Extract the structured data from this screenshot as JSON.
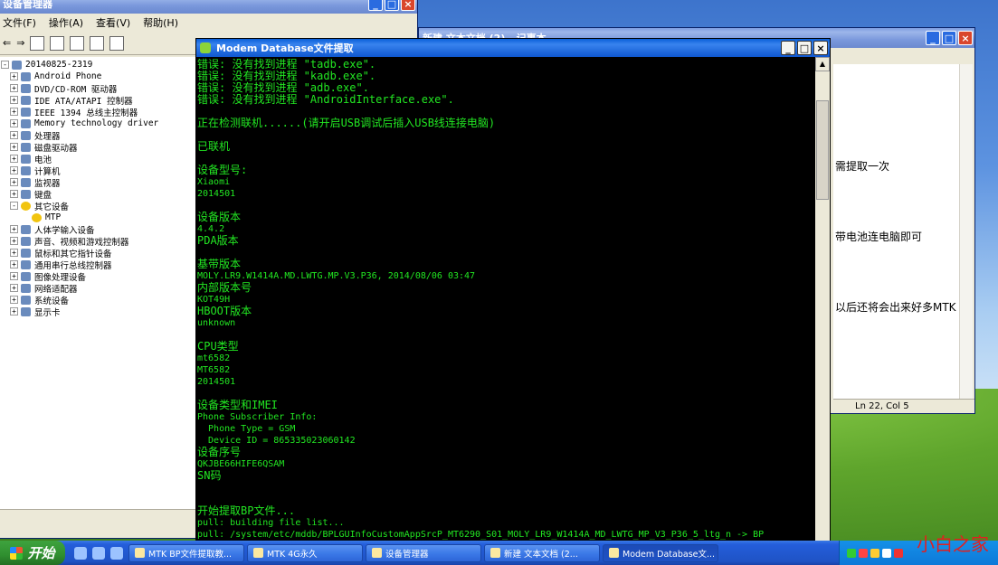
{
  "device_manager": {
    "title": "设备管理器",
    "menu": [
      "文件(F)",
      "操作(A)",
      "查看(V)",
      "帮助(H)"
    ],
    "root": "20140825-2319",
    "tree": [
      {
        "label": "Android Phone",
        "exp": "+"
      },
      {
        "label": "DVD/CD-ROM 驱动器",
        "exp": "+"
      },
      {
        "label": "IDE ATA/ATAPI 控制器",
        "exp": "+"
      },
      {
        "label": "IEEE 1394 总线主控制器",
        "exp": "+"
      },
      {
        "label": "Memory technology driver",
        "exp": "+"
      },
      {
        "label": "处理器",
        "exp": "+"
      },
      {
        "label": "磁盘驱动器",
        "exp": "+"
      },
      {
        "label": "电池",
        "exp": "+"
      },
      {
        "label": "计算机",
        "exp": "+"
      },
      {
        "label": "监视器",
        "exp": "+"
      },
      {
        "label": "键盘",
        "exp": "+"
      },
      {
        "label": "其它设备",
        "exp": "-"
      },
      {
        "label": "MTP",
        "exp": "",
        "child": true
      },
      {
        "label": "人体学输入设备",
        "exp": "+"
      },
      {
        "label": "声音、视频和游戏控制器",
        "exp": "+"
      },
      {
        "label": "鼠标和其它指针设备",
        "exp": "+"
      },
      {
        "label": "通用串行总线控制器",
        "exp": "+"
      },
      {
        "label": "图像处理设备",
        "exp": "+"
      },
      {
        "label": "网络适配器",
        "exp": "+"
      },
      {
        "label": "系统设备",
        "exp": "+"
      },
      {
        "label": "显示卡",
        "exp": "+"
      }
    ]
  },
  "notepad": {
    "title": "新建 文本文档 (2) - 记事本",
    "lines": [
      "需提取一次",
      "带电池连电脑即可",
      "以后还将会出来好多MTK"
    ],
    "status": "Ln 22, Col 5"
  },
  "console": {
    "title": "Modem Database文件提取",
    "lines": [
      "错误: 没有找到进程 \"tadb.exe\".",
      "错误: 没有找到进程 \"kadb.exe\".",
      "错误: 没有找到进程 \"adb.exe\".",
      "错误: 没有找到进程 \"AndroidInterface.exe\".",
      "",
      "正在检测联机......(请开启USB调试后插入USB线连接电脑)",
      "",
      "已联机",
      "",
      "设备型号:",
      "Xiaomi",
      "2014501",
      "",
      "设备版本",
      "4.4.2",
      "PDA版本",
      "",
      "基带版本",
      "MOLY.LR9.W1414A.MD.LWTG.MP.V3.P36, 2014/08/06 03:47",
      "内部版本号",
      "KOT49H",
      "HBOOT版本",
      "unknown",
      "",
      "CPU类型",
      "mt6582",
      "MT6582",
      "2014501",
      "",
      "设备类型和IMEI",
      "Phone Subscriber Info:",
      "  Phone Type = GSM",
      "  Device ID = 865335023060142",
      "设备序号",
      "QKJBE66HIFE6QSAM",
      "SN码",
      "",
      "",
      "开始提取BP文件...",
      "pull: building file list...",
      "pull: /system/etc/mddb/BPLGUInfoCustomAppSrcP_MT6290_S01_MOLY_LR9_W1414A_MD_LWTG_MP_V3_P36_5_ltg_n -> BP"
    ]
  },
  "taskbar": {
    "start": "开始",
    "tasks": [
      "MTK BP文件提取教...",
      "MTK 4G永久",
      "设备管理器",
      "新建 文本文档 (2...",
      "Modem Database文..."
    ],
    "active_task": 4
  },
  "watermark": "小白之家"
}
